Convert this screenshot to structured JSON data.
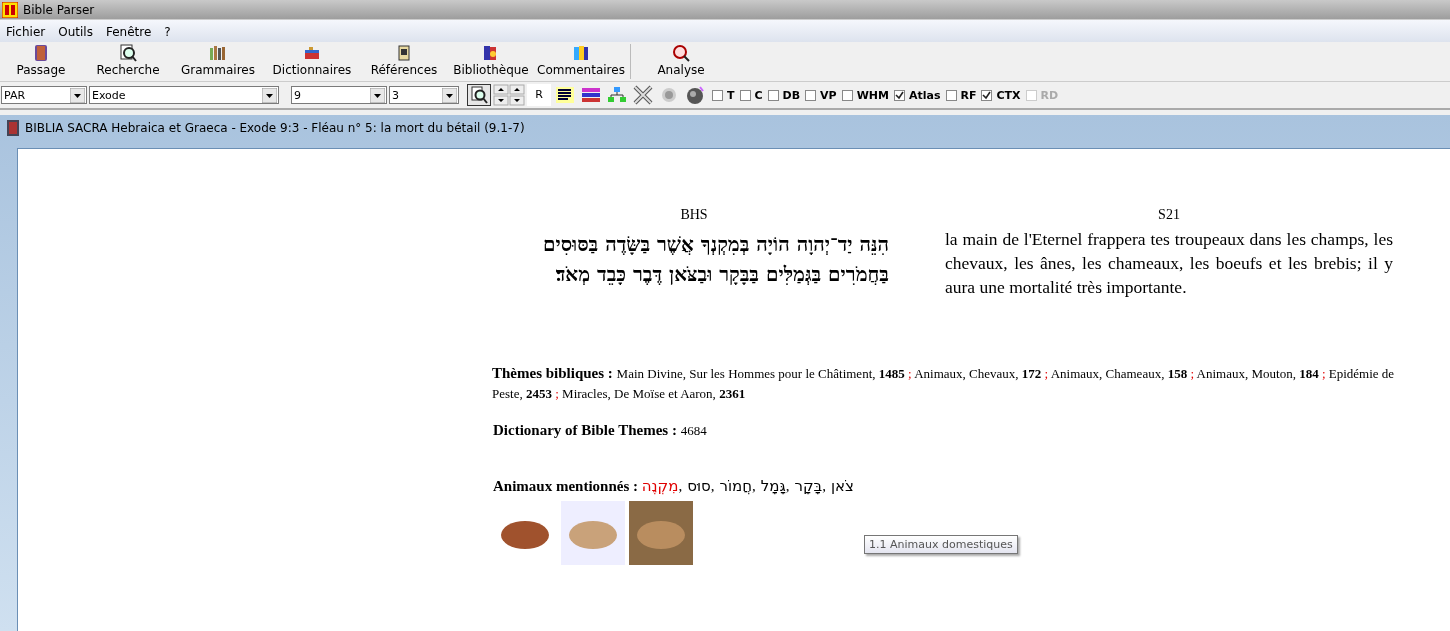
{
  "window": {
    "title": "Bible Parser"
  },
  "menu": [
    {
      "label": "Fichier"
    },
    {
      "label": "Outils"
    },
    {
      "label": "Fenêtre"
    },
    {
      "label": "?"
    }
  ],
  "toolbar": [
    {
      "label": "Passage"
    },
    {
      "label": "Recherche"
    },
    {
      "label": "Grammaires"
    },
    {
      "label": "Dictionnaires"
    },
    {
      "label": "Références"
    },
    {
      "label": "Bibliothèque"
    },
    {
      "label": "Commentaires"
    },
    {
      "label": "Analyse"
    }
  ],
  "selectors": [
    {
      "value": "PAR"
    },
    {
      "value": "Exode"
    },
    {
      "value": "9"
    },
    {
      "value": "3"
    }
  ],
  "option_buttons": [
    {
      "label": "R"
    }
  ],
  "checkboxes": [
    {
      "label": "T",
      "checked": false,
      "disabled": false
    },
    {
      "label": "C",
      "checked": false,
      "disabled": false
    },
    {
      "label": "DB",
      "checked": false,
      "disabled": false
    },
    {
      "label": "VP",
      "checked": false,
      "disabled": false
    },
    {
      "label": "WHM",
      "checked": false,
      "disabled": false
    },
    {
      "label": "Atlas",
      "checked": true,
      "disabled": false
    },
    {
      "label": "RF",
      "checked": false,
      "disabled": false
    },
    {
      "label": "CTX",
      "checked": true,
      "disabled": false
    },
    {
      "label": "RD",
      "checked": false,
      "disabled": true
    }
  ],
  "document": {
    "title": "BIBLIA SACRA Hebraica et Graeca - Exode 9:3 - Fléau n° 5: la mort du bétail (9.1-7)",
    "columns": [
      {
        "kind": "hebrew",
        "heading": "BHS",
        "lines": [
          "הִנֵּה יַד־יְהוָה הוֹיָה בְּמִקְנְךָ אֲשֶׁר בַּשָּׂדֶה בַּסּוּסִים",
          "בַּחֲמֹרִים בַּגְּמַלִּים בַּבָּקָר וּבַצֹּאן דֶּבֶר כָּבֵד מְאֹד׃"
        ]
      },
      {
        "kind": "french",
        "heading": "S21",
        "lines": [
          "la main de l'Eternel frappera tes troupeaux dans les champs, les chevaux, les ânes, les chameaux, les boeufs et les brebis; il y aura une mortalité très importante."
        ]
      }
    ],
    "themes": {
      "label": "Thèmes bibliques :",
      "separator": ";",
      "entries": [
        "Main Divine, Sur les Hommes pour le Châtiment, **1485**",
        "Animaux, Chevaux, **172**",
        "Animaux, Chameaux, **158**",
        "Animaux, Mouton, **184**",
        "Epidémie de Peste, **2453**",
        "Miracles, De Moïse et Aaron, **2361**"
      ]
    },
    "dictionary": {
      "label": "Dictionary of Bible Themes :",
      "value": "4684"
    },
    "animals": {
      "label": "Animaux mentionnés :",
      "separator": ",",
      "words": [
        {
          "text": "צֹאן",
          "highlighted": false
        },
        {
          "text": "בָּקָר",
          "highlighted": false
        },
        {
          "text": "גָּמָל",
          "highlighted": false
        },
        {
          "text": "חֲמוֹר",
          "highlighted": false
        },
        {
          "text": "סוּס",
          "highlighted": false
        },
        {
          "text": "מִקְנֶה",
          "highlighted": true
        }
      ]
    },
    "tooltip": {
      "text": "1.1 Animaux domestiques"
    }
  }
}
